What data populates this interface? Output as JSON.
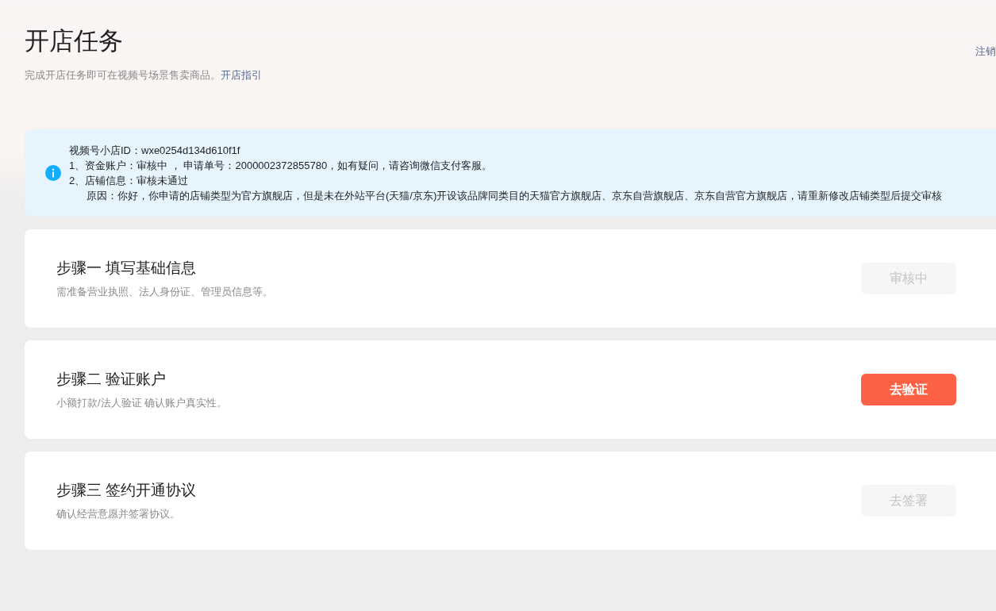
{
  "header": {
    "title": "开店任务",
    "subtitle": "完成开店任务即可在视频号场景售卖商品。",
    "guide_link": "开店指引",
    "logout_link": "注销"
  },
  "notice": {
    "shop_id": "视频号小店ID：wxe0254d134d610f1f",
    "lines": [
      "1、资金账户：审核中 ， 申请单号：2000002372855780，如有疑问，请咨询微信支付客服。",
      "2、店铺信息：审核未通过"
    ],
    "reason_label": "原因：",
    "reason_text": "你好，你申请的店铺类型为官方旗舰店，但是未在外站平台(天猫/京东)开设该品牌同类目的天猫官方旗舰店、京东自营旗舰店、京东自营官方旗舰店，请重新修改店铺类型后提交审核"
  },
  "steps": [
    {
      "title": "步骤一 填写基础信息",
      "description": "需准备营业执照、法人身份证、管理员信息等。",
      "button": {
        "label": "审核中",
        "disabled": true
      }
    },
    {
      "title": "步骤二 验证账户",
      "description": "小额打款/法人验证 确认账户真实性。",
      "button": {
        "label": "去验证",
        "disabled": false
      }
    },
    {
      "title": "步骤三 签约开通协议",
      "description": "确认经营意愿并签署协议。",
      "button": {
        "label": "去签署",
        "disabled": true
      }
    }
  ]
}
